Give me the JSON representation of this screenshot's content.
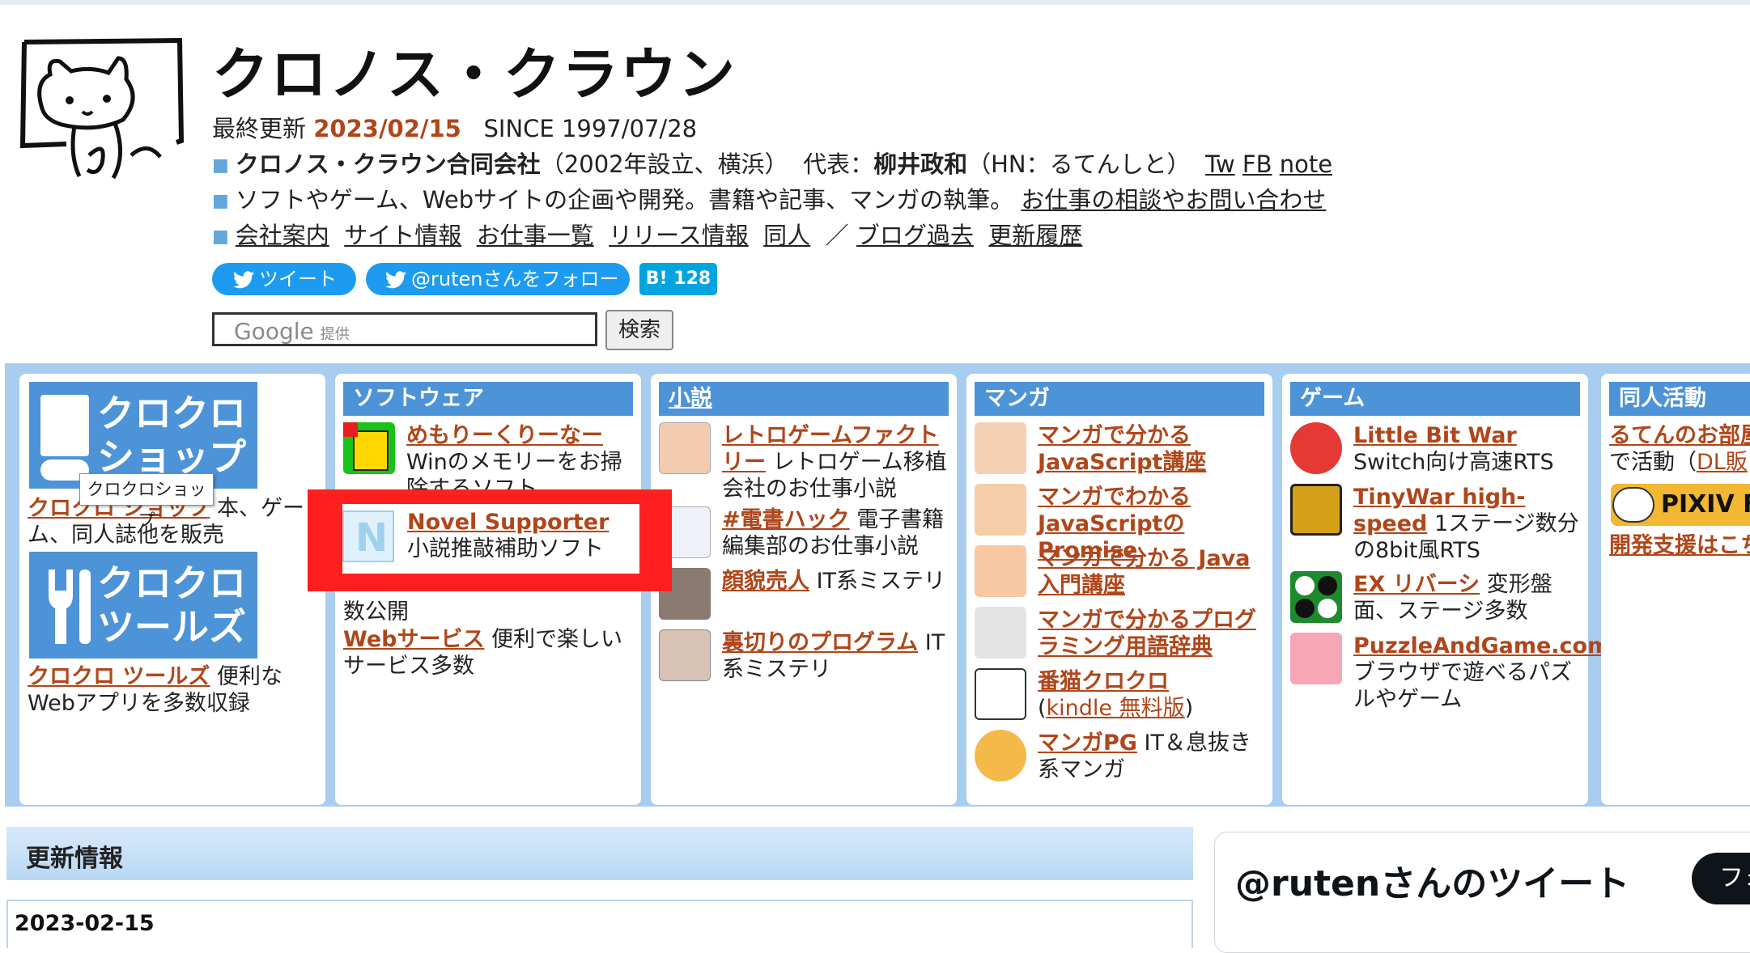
{
  "header": {
    "site_title": "クロノス・クラウン",
    "updated_label": "最終更新",
    "updated_date": "2023/02/15",
    "since": "SINCE 1997/07/28",
    "line1": {
      "company": "クロノス・クラウン合同会社",
      "founded": "（2002年設立、横浜）",
      "rep_label": "代表：",
      "rep_name": "柳井政和",
      "hn": "（HN：るてんしと）",
      "links": [
        "Tw",
        "FB",
        "note"
      ]
    },
    "line2": {
      "text": "ソフトやゲーム、Webサイトの企画や開発。書籍や記事、マンガの執筆。",
      "contact": "お仕事の相談やお問い合わせ"
    },
    "line3": {
      "links": [
        "会社案内",
        "サイト情報",
        "お仕事一覧",
        "リリース情報",
        "同人"
      ],
      "sep": "／",
      "links2": [
        "ブログ過去",
        "更新履歴"
      ]
    }
  },
  "social": {
    "tweet": "ツイート",
    "follow": "@rutenさんをフォロー",
    "hatena_b": "B!",
    "hatena_count": "128"
  },
  "search": {
    "google": "Google",
    "provided": "提供",
    "button": "検索"
  },
  "tooltip": "クロクロショップ",
  "categories": {
    "shop": {
      "banner1": "クロクロ ショップ",
      "item1_title": "クロクロ ショップ",
      "item1_desc": "本、ゲーム、同人誌他を販売",
      "banner2": "クロクロ ツールズ",
      "item2_title": "クロクロ ツールズ",
      "item2_desc": "便利なWebアプリを多数収録"
    },
    "software": {
      "head": "ソフトウェア",
      "items": [
        {
          "title": "めもりーくりーなー",
          "desc": "Winのメモリーをお掃除するソフト"
        },
        {
          "title": "Novel Supporter",
          "desc": "小説推敲補助ソフト"
        },
        {
          "title": "",
          "desc": "数公開"
        },
        {
          "title": "Webサービス",
          "desc": "便利で楽しいサービス多数"
        }
      ]
    },
    "novel": {
      "head": "小説",
      "items": [
        {
          "title": "レトロゲームファクトリー",
          "desc": "レトロゲーム移植会社のお仕事小説"
        },
        {
          "title": "#電書ハック",
          "desc": "電子書籍編集部のお仕事小説"
        },
        {
          "title": "顔貌売人",
          "desc": "IT系ミステリ"
        },
        {
          "title": "裏切りのプログラム",
          "desc": "IT系ミステリ"
        }
      ]
    },
    "manga": {
      "head": "マンガ",
      "items": [
        {
          "title": "マンガで分かるJavaScript講座",
          "desc": ""
        },
        {
          "title": "マンガでわかるJavaScriptのPromise",
          "desc": ""
        },
        {
          "title": "マンガで分かる Java入門講座",
          "desc": ""
        },
        {
          "title": "マンガで分かるプログラミング用語辞典",
          "desc": ""
        },
        {
          "title": "番猫クロクロ",
          "desc_pre": "(",
          "desc_link": "kindle 無料版",
          "desc_post": ")"
        },
        {
          "title": "マンガPG",
          "desc": "IT＆息抜き系マンガ"
        }
      ]
    },
    "game": {
      "head": "ゲーム",
      "items": [
        {
          "title": "Little Bit War",
          "desc": "Switch向け高速RTS"
        },
        {
          "title": "TinyWar high-speed",
          "desc": "1ステージ数分の8bit風RTS"
        },
        {
          "title": "EX リバーシ",
          "desc": "変形盤面、ステージ多数"
        },
        {
          "title": "PuzzleAndGame.com",
          "desc": "ブラウザで遊べるパズルやゲーム"
        }
      ]
    },
    "doujin": {
      "head": "同人活動",
      "item1_title": "るてんのお部屋",
      "item1_desc": "で活動（",
      "item1_link": "DL販",
      "banner": "PIXIV FA",
      "item2_title": "開発支援はこち"
    }
  },
  "updates": {
    "head": "更新情報",
    "date": "2023-02-15"
  },
  "twitter": {
    "title": "@rutenさんのツイート",
    "follow": "フォ"
  },
  "colors": {
    "accent_link": "#b0461a",
    "category_head": "#4d93d7",
    "band": "#a8cdee",
    "twitter": "#1d9bf0",
    "highlight": "#ff1f1f"
  }
}
